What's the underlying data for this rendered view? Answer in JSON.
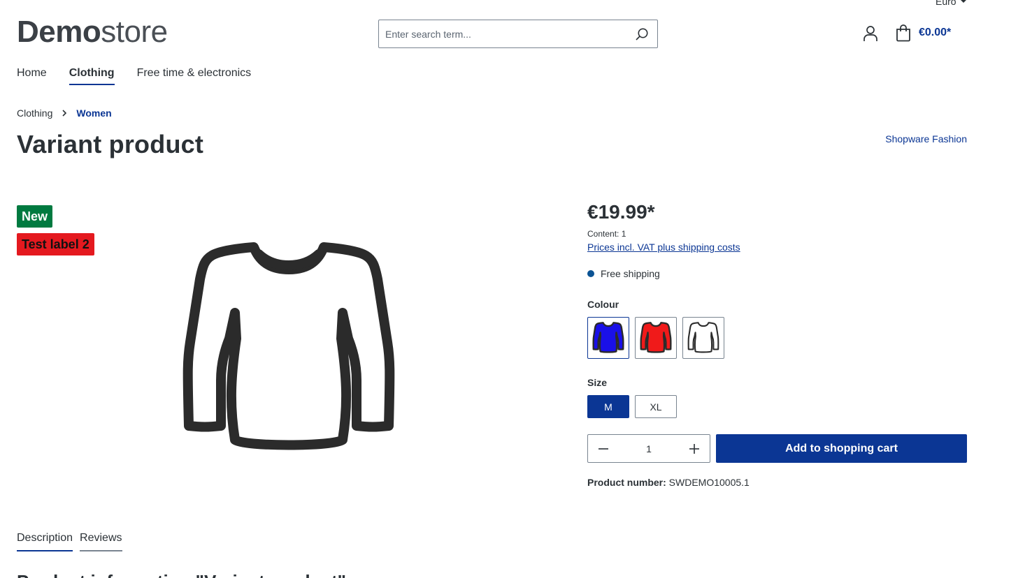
{
  "header": {
    "currency": "Euro",
    "logo": {
      "bold": "Demo",
      "light": "store"
    },
    "search": {
      "placeholder": "Enter search term..."
    },
    "cart_total": "€0.00*"
  },
  "nav": {
    "items": [
      {
        "label": "Home",
        "active": false
      },
      {
        "label": "Clothing",
        "active": true
      },
      {
        "label": "Free time & electronics",
        "active": false
      }
    ]
  },
  "breadcrumb": {
    "items": [
      {
        "label": "Clothing"
      },
      {
        "label": "Women"
      }
    ]
  },
  "product": {
    "title": "Variant product",
    "manufacturer": "Shopware Fashion",
    "badges": {
      "new": "New",
      "test": "Test label 2"
    },
    "price": "€19.99*",
    "content": "Content: 1",
    "vat_link": "Prices incl. VAT plus shipping costs",
    "delivery": "Free shipping",
    "colour_label": "Colour",
    "colours": [
      {
        "name": "blue",
        "hex": "#1a10e8",
        "selected": true
      },
      {
        "name": "red",
        "hex": "#f01a1a",
        "selected": false
      },
      {
        "name": "white",
        "hex": "#ffffff",
        "selected": false
      }
    ],
    "size_label": "Size",
    "sizes": [
      {
        "label": "M",
        "selected": true
      },
      {
        "label": "XL",
        "selected": false
      }
    ],
    "quantity": "1",
    "add_to_cart": "Add to shopping cart",
    "product_number_label": "Product number:",
    "product_number": "SWDEMO10005.1"
  },
  "tabs": [
    {
      "label": "Description",
      "active": true
    },
    {
      "label": "Reviews",
      "active": false
    }
  ],
  "description_heading": "Product information \"Variant product\"",
  "colors": {
    "accent": "#0b3694",
    "new_badge": "#007a40",
    "test_badge": "#e4191f",
    "text": "#2b3136"
  }
}
